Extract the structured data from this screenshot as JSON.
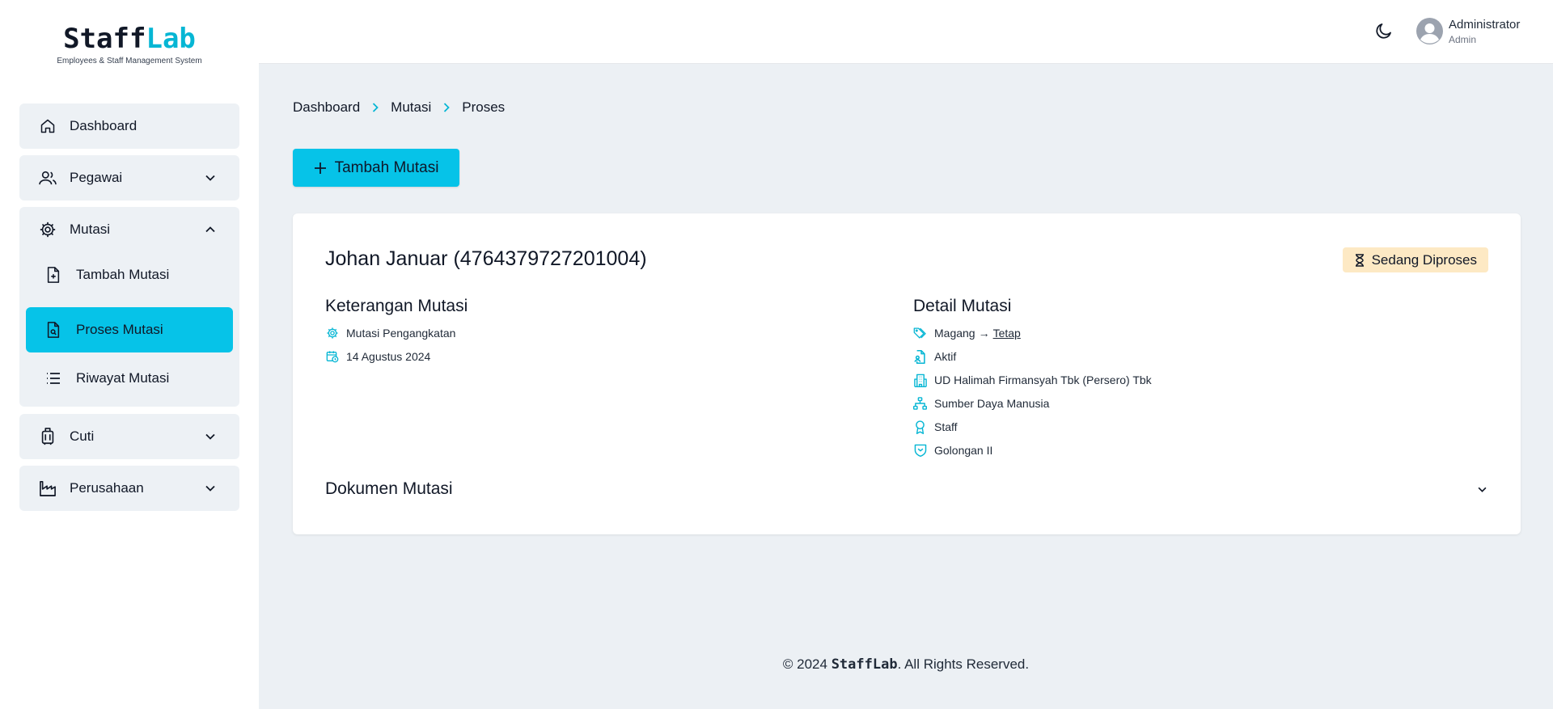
{
  "brand": {
    "name_part1": "Staff",
    "name_part2": "Lab",
    "tagline": "Employees & Staff Management System",
    "accent_color": "#06b6d4"
  },
  "sidebar": {
    "items": [
      {
        "label": "Dashboard",
        "icon": "home-icon"
      },
      {
        "label": "Pegawai",
        "icon": "users-icon",
        "expandable": true,
        "expanded": false
      },
      {
        "label": "Mutasi",
        "icon": "gear-icon",
        "expandable": true,
        "expanded": true,
        "children": [
          {
            "label": "Tambah Mutasi",
            "icon": "file-plus-icon"
          },
          {
            "label": "Proses Mutasi",
            "icon": "file-search-icon",
            "active": true
          },
          {
            "label": "Riwayat Mutasi",
            "icon": "list-icon"
          }
        ]
      },
      {
        "label": "Cuti",
        "icon": "luggage-icon",
        "expandable": true,
        "expanded": false
      },
      {
        "label": "Perusahaan",
        "icon": "factory-icon",
        "expandable": true,
        "expanded": false
      }
    ],
    "active_color": "#06c3e8"
  },
  "header": {
    "theme_toggle_icon": "moon-icon",
    "user_name": "Administrator",
    "user_role": "Admin"
  },
  "breadcrumb": [
    "Dashboard",
    "Mutasi",
    "Proses"
  ],
  "actions": {
    "add_label": "Tambah Mutasi"
  },
  "mutation": {
    "employee": "Johan Januar (4764379727201004)",
    "status": "Sedang Diproses",
    "status_color": "#fde9c4",
    "keterangan": {
      "title": "Keterangan Mutasi",
      "type": "Mutasi Pengangkatan",
      "date": "14 Agustus 2024"
    },
    "detail": {
      "title": "Detail Mutasi",
      "status_from": "Magang",
      "arrow": "→",
      "status_to": "Tetap",
      "employment": "Aktif",
      "company": "UD Halimah Firmansyah Tbk (Persero) Tbk",
      "department": "Sumber Daya Manusia",
      "position": "Staff",
      "grade": "Golongan II"
    },
    "documents_title": "Dokumen Mutasi"
  },
  "footer": {
    "prefix": "© 2024 ",
    "brand": "StaffLab",
    "suffix": ". All Rights Reserved."
  }
}
